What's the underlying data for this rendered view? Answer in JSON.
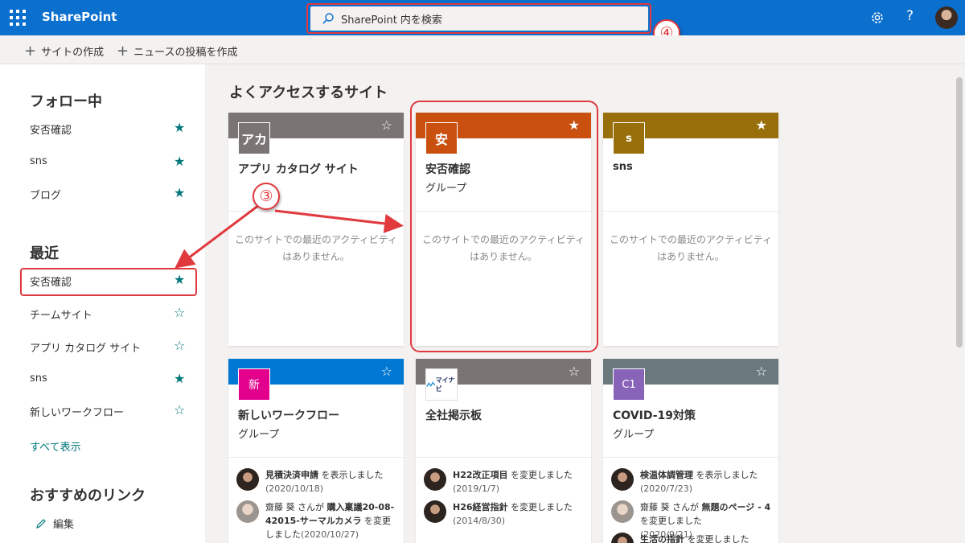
{
  "topbar": {
    "brand": "SharePoint",
    "search_placeholder": "SharePoint 内を検索",
    "help": "?"
  },
  "commands": {
    "create_site": "サイトの作成",
    "create_news": "ニュースの投稿を作成"
  },
  "leftnav": {
    "following_title": "フォロー中",
    "following": [
      {
        "label": "安否確認",
        "star": "★"
      },
      {
        "label": "sns",
        "star": "★"
      },
      {
        "label": "ブログ",
        "star": "★"
      }
    ],
    "recent_title": "最近",
    "recent": [
      {
        "label": "安否確認",
        "star": "★"
      },
      {
        "label": "チームサイト",
        "star": "☆"
      },
      {
        "label": "アプリ カタログ サイト",
        "star": "☆"
      },
      {
        "label": "sns",
        "star": "★"
      },
      {
        "label": "新しいワークフロー",
        "star": "☆"
      }
    ],
    "see_all": "すべて表示",
    "links_title": "おすすめのリンク",
    "edit": "編集"
  },
  "main": {
    "title": "よくアクセスするサイト",
    "empty_line1": "このサイトでの最近のアクティビティ",
    "empty_line2": "はありません。",
    "cards": [
      {
        "name": "アプリ カタログ サイト",
        "type": "",
        "logo": "アカ",
        "star": "☆",
        "head_color": "#7a7574",
        "logo_color": "#7a7574"
      },
      {
        "name": "安否確認",
        "type": "グループ",
        "logo": "安",
        "star": "★",
        "head_color": "#ca5010",
        "logo_color": "#ca5010"
      },
      {
        "name": "sns",
        "type": "",
        "logo": "s",
        "star": "★",
        "head_color": "#986f0b",
        "logo_color": "#986f0b"
      },
      {
        "name": "新しいワークフロー",
        "type": "グループ",
        "logo": "新",
        "star": "☆",
        "head_color": "#0078d4",
        "logo_color": "#e3008c"
      },
      {
        "name": "全社掲示板",
        "type": "",
        "logo": "マイナビ",
        "star": "☆",
        "head_color": "#7a7574",
        "logo_color": "#ffffff"
      },
      {
        "name": "COVID-19対策",
        "type": "グループ",
        "logo": "C1",
        "star": "☆",
        "head_color": "#69797e",
        "logo_color": "#8764b8"
      }
    ],
    "activities": {
      "card4": [
        {
          "doc": "見積決済申請",
          "action": " を表示しました",
          "date": "(2020/10/18)"
        },
        {
          "user": "齋藤 葵",
          "mid": " さんが ",
          "doc": "購入稟議20-08-42015-サーマルカメラ",
          "action": " を変更しました",
          "date": "(2020/10/27)"
        }
      ],
      "card5": [
        {
          "doc": "H22改正項目",
          "action": " を変更しました",
          "date": "(2019/1/7)"
        },
        {
          "doc": "H26経営指針",
          "action": " を変更しました",
          "date": "(2014/8/30)"
        }
      ],
      "card6": [
        {
          "doc": "検温体調管理",
          "action": " を表示しました",
          "date": "(2020/7/23)"
        },
        {
          "user": "齋藤 葵",
          "mid": " さんが ",
          "doc": "無題のページ - 4",
          "action": " を変更しました",
          "date": "(2020/9/21)"
        },
        {
          "doc": "生活の指針",
          "action": " を変更しました"
        }
      ]
    }
  },
  "annotations": {
    "badge3": "③",
    "badge4": "④"
  },
  "colors": {
    "suite_bar": "#0b6fce",
    "accent_star": "#03787c",
    "annotation": "#e0393e"
  }
}
